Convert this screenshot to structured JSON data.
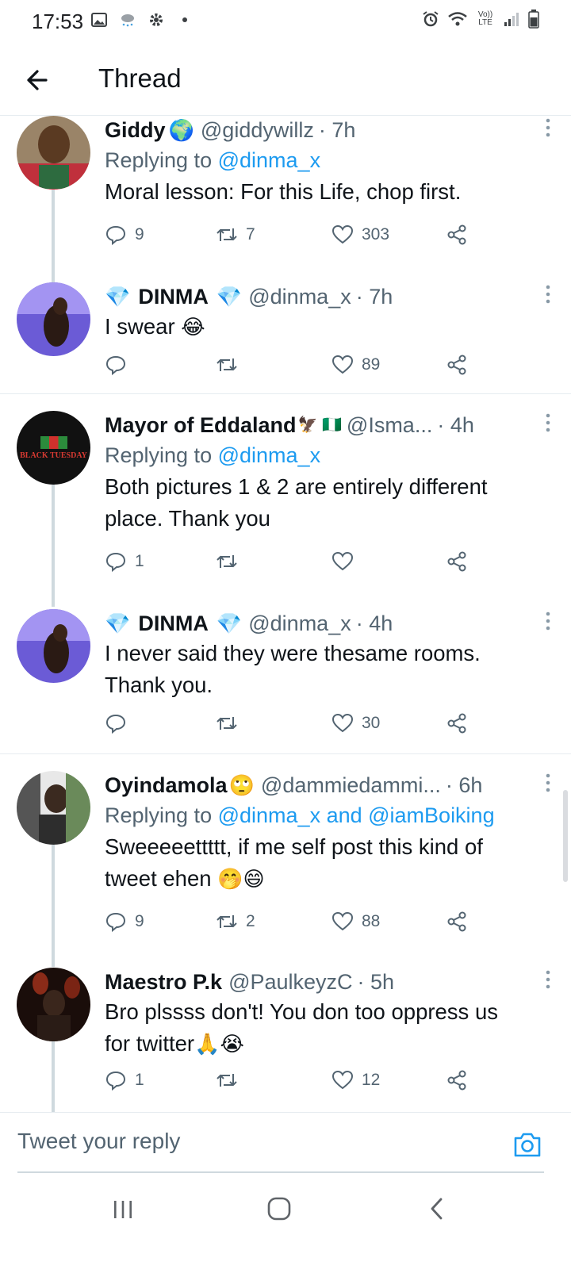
{
  "status_bar": {
    "time": "17:53",
    "left_icons": [
      "gallery-icon",
      "weather-icon",
      "settings-icon",
      "dot-icon"
    ],
    "right_icons": [
      "alarm-icon",
      "wifi-icon",
      "volte-icon",
      "signal-icon",
      "battery-icon"
    ],
    "volte_text": "Vo)) LTE"
  },
  "header": {
    "title": "Thread"
  },
  "tweets": [
    {
      "name": "Giddy",
      "name_emoji": "🌍",
      "handle": "@giddywillz",
      "time": "· 7h",
      "replying_prefix": "Replying to",
      "replying_to": "@dinma_x",
      "text": "Moral lesson: For this Life, chop first.",
      "replies": "9",
      "retweets": "7",
      "likes": "303"
    },
    {
      "name_prefix_emoji": "💎",
      "name": "DINMA",
      "name_emoji": "💎",
      "handle": "@dinma_x",
      "time": "· 7h",
      "text": "I swear",
      "text_emoji": "😂",
      "replies": "",
      "retweets": "",
      "likes": "89"
    },
    {
      "name": "Mayor of Eddaland",
      "name_emoji": "🦅 🇳🇬",
      "handle": "@Isma...",
      "time": "· 4h",
      "replying_prefix": "Replying to",
      "replying_to": "@dinma_x",
      "text_line1": "Both pictures 1 & 2 are entirely different",
      "text_line2": "place. Thank you",
      "replies": "1",
      "retweets": "",
      "likes": "",
      "avatar_text": "BLACK TUESDAY"
    },
    {
      "name_prefix_emoji": "💎",
      "name": "DINMA",
      "name_emoji": "💎",
      "handle": "@dinma_x",
      "time": "· 4h",
      "text_line1": "I never said they were thesame rooms.",
      "text_line2": "Thank you.",
      "replies": "",
      "retweets": "",
      "likes": "30"
    },
    {
      "name": "Oyindamola",
      "name_emoji": "🙄",
      "handle": "@dammiedammi...",
      "time": "· 6h",
      "replying_prefix": "Replying to",
      "replying_to": "@dinma_x and @iamBoiking",
      "text_line1": "Sweeeeettttt, if me self post this kind of",
      "text_line2": "tweet ehen",
      "text_emoji": "🤭😄",
      "replies": "9",
      "retweets": "2",
      "likes": "88"
    },
    {
      "name": "Maestro P.k",
      "handle": "@PaulkeyzC",
      "time": "· 5h",
      "text_line1": "Bro plssss don't! You don too oppress us",
      "text_line2": "for twitter",
      "text_emoji": "🙏😭",
      "replies": "1",
      "retweets": "",
      "likes": "12"
    }
  ],
  "composer": {
    "placeholder": "Tweet your reply"
  },
  "colors": {
    "accent": "#1d9bf0",
    "secondary_text": "#536471",
    "divider": "#e6ecf0"
  }
}
